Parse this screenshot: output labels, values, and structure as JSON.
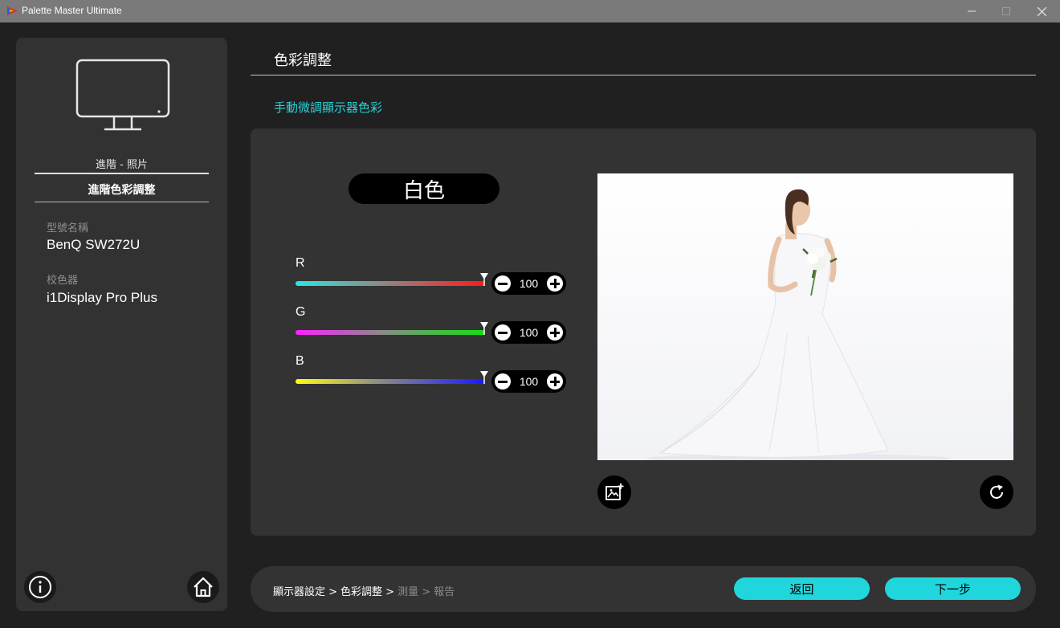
{
  "window": {
    "title": "Palette Master Ultimate",
    "minimize_icon": "minimize-icon",
    "maximize_icon": "maximize-icon",
    "close_icon": "close-icon"
  },
  "sidebar": {
    "mode": "進階 - 照片",
    "current_step": "進階色彩調整",
    "model_label": "型號名稱",
    "model_value": "BenQ SW272U",
    "calibrator_label": "校色器",
    "calibrator_value": "i1Display Pro Plus",
    "info_icon": "info-icon",
    "home_icon": "home-icon"
  },
  "main": {
    "page_title": "色彩調整",
    "section_title": "手動微調顯示器色彩",
    "target_color": "白色",
    "channels": [
      {
        "label": "R",
        "value": "100"
      },
      {
        "label": "G",
        "value": "100"
      },
      {
        "label": "B",
        "value": "100"
      }
    ],
    "preview_icons": [
      "change-image-icon",
      "reset-icon"
    ]
  },
  "footer": {
    "breadcrumbs": [
      {
        "text": "顯示器設定 >",
        "state": "done"
      },
      {
        "text": "色彩調整 >",
        "state": "current"
      },
      {
        "text": "測量 >",
        "state": "pending"
      },
      {
        "text": "報告",
        "state": "pending"
      }
    ],
    "back_label": "返回",
    "next_label": "下一步"
  },
  "colors": {
    "accent": "#20d6dc",
    "panel": "#333333",
    "background": "#202020",
    "titlebar": "#7a7a7a"
  }
}
